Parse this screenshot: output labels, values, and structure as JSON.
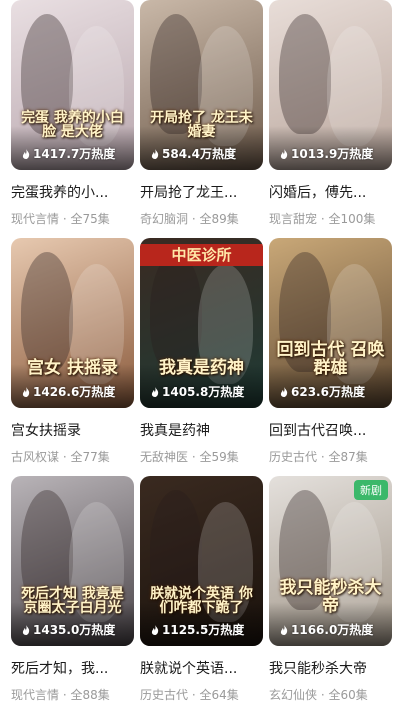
{
  "colors": {
    "accent_new_badge": "#3bb86a",
    "title_text": "#1a1a1a",
    "meta_text": "#9a9a9a"
  },
  "cards": [
    {
      "title": "完蛋我养的小...",
      "meta": "现代言情 · 全75集",
      "heat": "1417.7万热度",
      "poster_text": "完蛋 我养的小白脸 是大佬",
      "poster_bg": [
        "#e9dfe2",
        "#b8a6ad"
      ]
    },
    {
      "title": "开局抢了龙王...",
      "meta": "奇幻脑洞 · 全89集",
      "heat": "584.4万热度",
      "poster_text": "开局抢了 龙王未婚妻",
      "poster_bg": [
        "#c9b8a8",
        "#6d5a4a"
      ]
    },
    {
      "title": "闪婚后，傅先...",
      "meta": "现言甜宠 · 全100集",
      "heat": "1013.9万热度",
      "poster_text": "",
      "poster_bg": [
        "#e8ddd8",
        "#b9a69c"
      ]
    },
    {
      "title": "宫女扶摇录",
      "meta": "古风权谋 · 全77集",
      "heat": "1426.6万热度",
      "poster_text": "宫女 扶摇录",
      "poster_bg": [
        "#e7c9b0",
        "#8a5a3c"
      ]
    },
    {
      "title": "我真是药神",
      "meta": "无敌神医 · 全59集",
      "heat": "1405.8万热度",
      "poster_text": "我真是药神",
      "poster_header": "中医诊所",
      "poster_bg": [
        "#3a2a22",
        "#1f3b35"
      ]
    },
    {
      "title": "回到古代召唤...",
      "meta": "历史古代 · 全87集",
      "heat": "623.6万热度",
      "poster_text": "回到古代 召唤群雄",
      "poster_bg": [
        "#c9a878",
        "#5c4630"
      ]
    },
    {
      "title": "死后才知，我...",
      "meta": "现代言情 · 全88集",
      "heat": "1435.0万热度",
      "poster_text": "死后才知 我竟是京圈太子白月光",
      "poster_bg": [
        "#b9b4b8",
        "#4a4448"
      ]
    },
    {
      "title": "朕就说个英语...",
      "meta": "历史古代 · 全64集",
      "heat": "1125.5万热度",
      "poster_text": "朕就说个英语 你们咋都下跪了",
      "poster_bg": [
        "#3a2a20",
        "#1a120c"
      ]
    },
    {
      "title": "我只能秒杀大帝",
      "meta": "玄幻仙侠 · 全60集",
      "heat": "1166.0万热度",
      "poster_text": "我只能秒杀大帝",
      "badge": "新剧",
      "poster_bg": [
        "#e4e0dc",
        "#9f9486"
      ]
    }
  ]
}
